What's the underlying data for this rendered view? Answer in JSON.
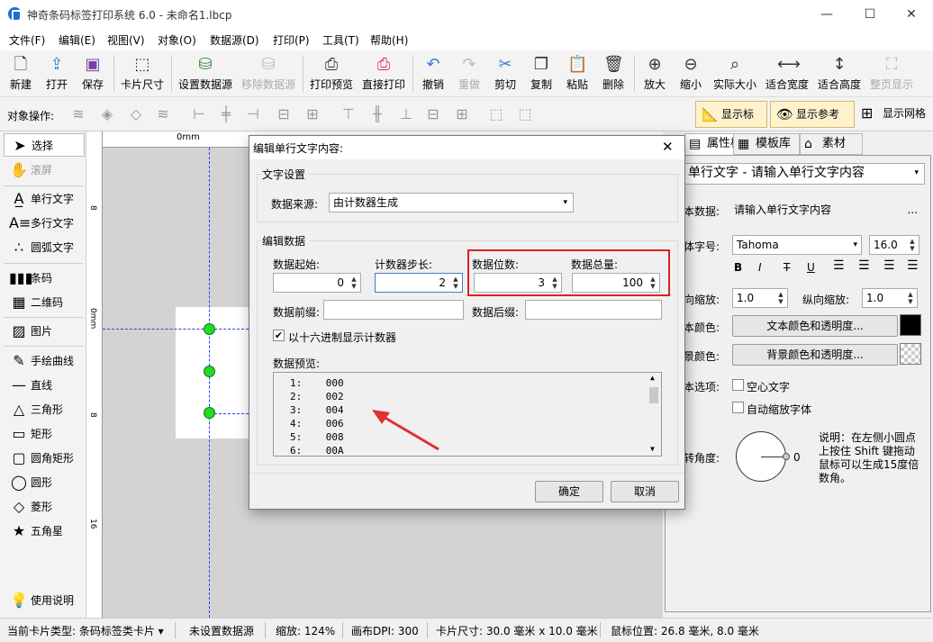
{
  "window": {
    "title": "神奇条码标签打印系统 6.0 - 未命名1.lbcp",
    "minimize": "—",
    "maximize": "☐",
    "close": "✕"
  },
  "menu": [
    "文件(F)",
    "编辑(E)",
    "视图(V)",
    "对象(O)",
    "数据源(D)",
    "打印(P)",
    "工具(T)",
    "帮助(H)"
  ],
  "toolbar": [
    {
      "label": "新建",
      "icon": "new-file-icon",
      "enabled": true
    },
    {
      "label": "打开",
      "icon": "open-icon",
      "enabled": true
    },
    {
      "label": "保存",
      "icon": "save-icon",
      "enabled": true
    },
    {
      "label": "卡片尺寸",
      "icon": "card-size-icon",
      "enabled": true
    },
    {
      "label": "设置数据源",
      "icon": "database-icon",
      "enabled": true
    },
    {
      "label": "移除数据源",
      "icon": "database-remove-icon",
      "enabled": false
    },
    {
      "label": "打印预览",
      "icon": "print-preview-icon",
      "enabled": true
    },
    {
      "label": "直接打印",
      "icon": "printer-icon",
      "enabled": true
    },
    {
      "label": "撤销",
      "icon": "undo-icon",
      "enabled": true
    },
    {
      "label": "重做",
      "icon": "redo-icon",
      "enabled": false
    },
    {
      "label": "剪切",
      "icon": "scissors-icon",
      "enabled": true
    },
    {
      "label": "复制",
      "icon": "copy-icon",
      "enabled": true
    },
    {
      "label": "粘贴",
      "icon": "paste-icon",
      "enabled": true
    },
    {
      "label": "删除",
      "icon": "trash-icon",
      "enabled": true
    },
    {
      "label": "放大",
      "icon": "zoom-in-icon",
      "enabled": true
    },
    {
      "label": "缩小",
      "icon": "zoom-out-icon",
      "enabled": true
    },
    {
      "label": "实际大小",
      "icon": "zoom-actual-icon",
      "enabled": true
    },
    {
      "label": "适合宽度",
      "icon": "fit-width-icon",
      "enabled": true
    },
    {
      "label": "适合高度",
      "icon": "fit-height-icon",
      "enabled": true
    },
    {
      "label": "整页显示",
      "icon": "fit-page-icon",
      "enabled": false
    }
  ],
  "objects_bar": {
    "label": "对象操作:",
    "show_ruler": "显示标尺",
    "show_guides": "显示参考线",
    "show_grid": "显示网格"
  },
  "tools": [
    "选择",
    "滚屏",
    "单行文字",
    "多行文字",
    "圆弧文字",
    "条码",
    "二维码",
    "图片",
    "手绘曲线",
    "直线",
    "三角形",
    "矩形",
    "圆角矩形",
    "圆形",
    "菱形",
    "五角星",
    "使用说明"
  ],
  "ruler": {
    "h0": "0mm",
    "v0": "0mm",
    "h8": "8",
    "v8": "8",
    "v16": "16"
  },
  "right_panel": {
    "tabs": [
      "属性栏",
      "模板库",
      "素材库"
    ],
    "object_select": "单行文字 - 请输入单行文字内容",
    "text_data_label": "本数据:",
    "text_data_value": "请输入单行文字内容",
    "ellipsis": "...",
    "font_label": "体字号:",
    "font_name": "Tahoma",
    "font_size": "16.0",
    "style_buttons": [
      "B",
      "I",
      "T",
      "U"
    ],
    "hscale_label": "向缩放:",
    "hscale": "1.0",
    "vscale_label": "纵向缩放:",
    "vscale": "1.0",
    "text_color_label": "本颜色:",
    "text_color_btn": "文本颜色和透明度...",
    "bg_color_label": "景颜色:",
    "bg_color_btn": "背景颜色和透明度...",
    "options_label": "本选项:",
    "hollow_text": "空心文字",
    "auto_scale_font": "自动缩放字体",
    "rotate_label": "转角度:",
    "rotate_value": "0",
    "rotate_note": "说明：在左侧小圆点上按住 Shift 键拖动鼠标可以生成15度倍数角。",
    "text_color": "#000000"
  },
  "dialog": {
    "title": "编辑单行文字内容:",
    "close": "✕",
    "group_text": "文字设置",
    "source_label": "数据来源:",
    "source_value": "由计数器生成",
    "group_data": "编辑数据",
    "start_label": "数据起始:",
    "start_value": "0",
    "step_label": "计数器步长:",
    "step_value": "2",
    "digits_label": "数据位数:",
    "digits_value": "3",
    "total_label": "数据总量:",
    "total_value": "100",
    "prefix_label": "数据前缀:",
    "prefix_value": "",
    "suffix_label": "数据后缀:",
    "suffix_value": "",
    "hex_label": "以十六进制显示计数器",
    "hex_checked": true,
    "preview_label": "数据预览:",
    "preview": [
      {
        "n": "1:",
        "v": "000"
      },
      {
        "n": "2:",
        "v": "002"
      },
      {
        "n": "3:",
        "v": "004"
      },
      {
        "n": "4:",
        "v": "006"
      },
      {
        "n": "5:",
        "v": "008"
      },
      {
        "n": "6:",
        "v": "00A"
      }
    ],
    "ok": "确定",
    "cancel": "取消"
  },
  "status": {
    "card_type": "当前卡片类型: 条码标签类卡片",
    "datasource": "未设置数据源",
    "zoom": "缩放: 124%",
    "dpi": "画布DPI: 300",
    "card_size": "卡片尺寸: 30.0 毫米 x 10.0 毫米",
    "mouse": "鼠标位置: 26.8 毫米, 8.0 毫米"
  },
  "colors": {
    "highlight": "#e02020",
    "guide": "#2040ff",
    "handle": "#22dd22",
    "arrow": "#e03030"
  }
}
